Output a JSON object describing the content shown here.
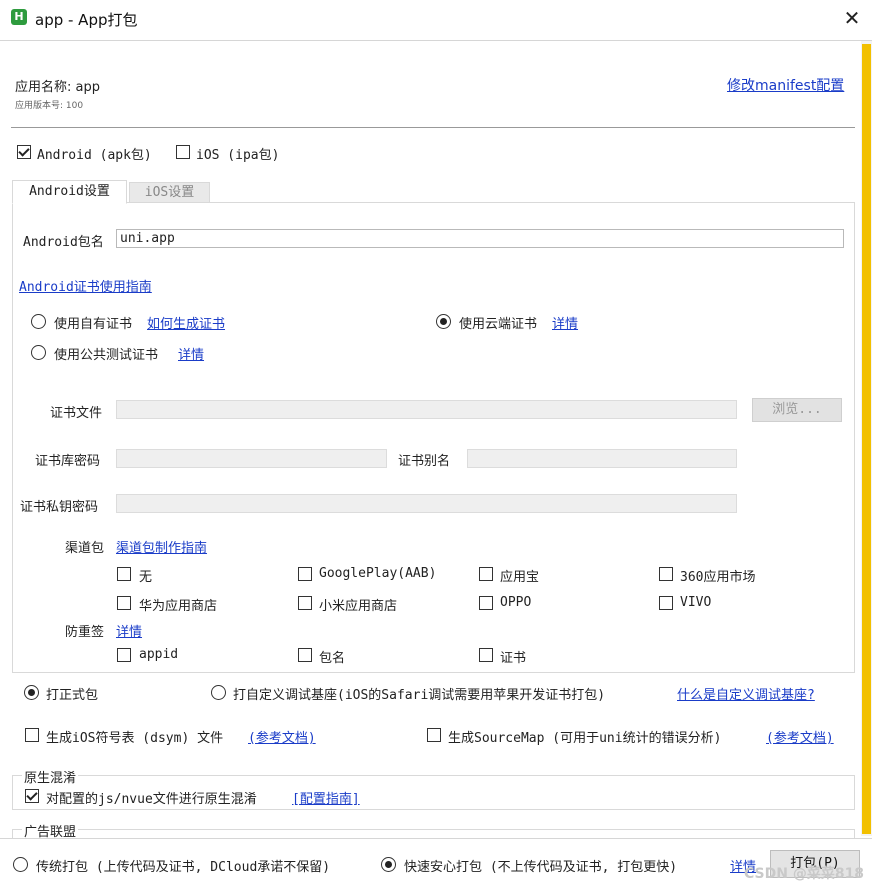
{
  "window": {
    "title": "app - App打包",
    "app_icon_glyph": "H",
    "close_glyph": "✕"
  },
  "header": {
    "app_name": "应用名称: app",
    "app_version": "应用版本号: 100",
    "modify_manifest_link": "修改manifest配置"
  },
  "platforms": {
    "android_label": "Android (apk包)",
    "android_checked": true,
    "ios_label": "iOS (ipa包)",
    "ios_checked": false
  },
  "tabs": {
    "android": "Android设置",
    "ios": "iOS设置"
  },
  "android": {
    "package_label": "Android包名",
    "package_value": "uni.app",
    "cert_guide_link": "Android证书使用指南",
    "cert_options": {
      "own": {
        "label": "使用自有证书",
        "link": "如何生成证书",
        "selected": false
      },
      "cloud": {
        "label": "使用云端证书",
        "link": "详情",
        "selected": true
      },
      "public": {
        "label": "使用公共测试证书",
        "link": "详情",
        "selected": false
      }
    },
    "cert_file_label": "证书文件",
    "browse_label": "浏览...",
    "keystore_pwd_label": "证书库密码",
    "alias_label": "证书别名",
    "key_pwd_label": "证书私钥密码",
    "channel_label": "渠道包",
    "channel_link": "渠道包制作指南",
    "channels": [
      {
        "label": "无",
        "checked": false
      },
      {
        "label": "GooglePlay(AAB)",
        "checked": false
      },
      {
        "label": "应用宝",
        "checked": false
      },
      {
        "label": "360应用市场",
        "checked": false
      },
      {
        "label": "华为应用商店",
        "checked": false
      },
      {
        "label": "小米应用商店",
        "checked": false
      },
      {
        "label": "OPPO",
        "checked": false
      },
      {
        "label": "VIVO",
        "checked": false
      }
    ],
    "anti_resign_label": "防重签",
    "anti_resign_link": "详情",
    "anti_resign_options": [
      {
        "label": "appid",
        "checked": false
      },
      {
        "label": "包名",
        "checked": false
      },
      {
        "label": "证书",
        "checked": false
      }
    ]
  },
  "build_type": {
    "release": {
      "label": "打正式包",
      "selected": true
    },
    "custom_base": {
      "label": "打自定义调试基座(iOS的Safari调试需要用苹果开发证书打包)",
      "selected": false
    },
    "custom_base_link": "什么是自定义调试基座?"
  },
  "options": {
    "dsym": {
      "label": "生成iOS符号表 (dsym) 文件",
      "link": "(参考文档)",
      "checked": false
    },
    "sourcemap": {
      "label": "生成SourceMap (可用于uni统计的错误分析)",
      "link": "(参考文档)",
      "checked": false
    }
  },
  "obfuscation": {
    "title": "原生混淆",
    "label": "对配置的js/nvue文件进行原生混淆",
    "link": "[配置指南]",
    "checked": true
  },
  "ad": {
    "title": "广告联盟"
  },
  "footer": {
    "traditional": {
      "label": "传统打包 (上传代码及证书, DCloud承诺不保留)",
      "selected": false
    },
    "fast": {
      "label": "快速安心打包 (不上传代码及证书, 打包更快)",
      "selected": true
    },
    "details_link": "详情",
    "pack_button": "打包(P)",
    "watermark": "CSDN @菜菜818"
  }
}
